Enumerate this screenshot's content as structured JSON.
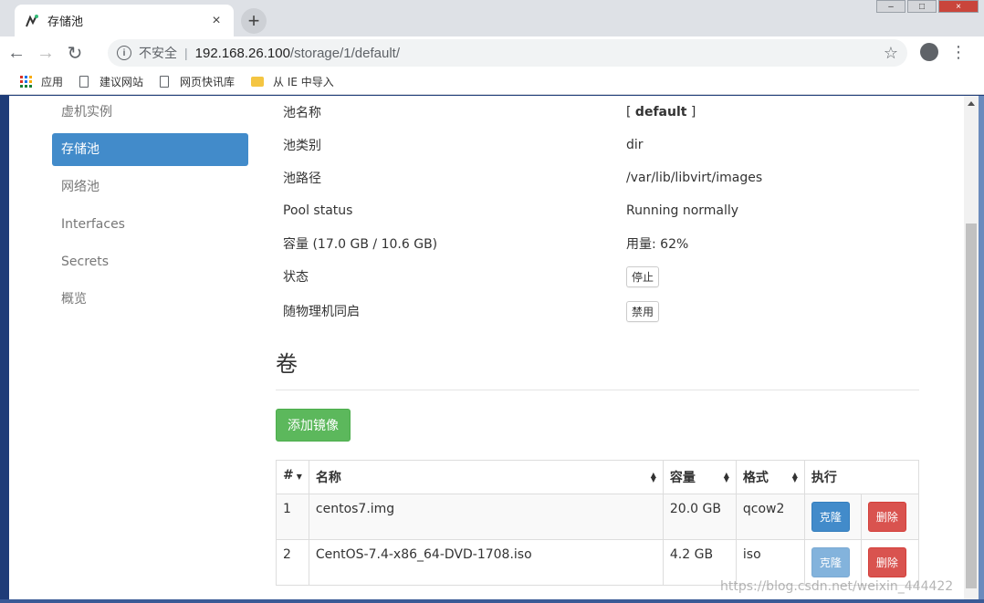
{
  "browser": {
    "tab_title": "存储池",
    "tab_close": "×",
    "new_tab": "+",
    "insecure_label": "不安全",
    "url_host": "192.168.26.100",
    "url_path": "/storage/1/default/",
    "bookmarks": [
      {
        "label": "应用",
        "icon": "apps-grid-icon"
      },
      {
        "label": "建议网站",
        "icon": "page-icon"
      },
      {
        "label": "网页快讯库",
        "icon": "page-icon"
      },
      {
        "label": "从 IE 中导入",
        "icon": "folder-icon"
      }
    ]
  },
  "sidebar": {
    "items": [
      {
        "label": "虚机实例",
        "active": false
      },
      {
        "label": "存储池",
        "active": true
      },
      {
        "label": "网络池",
        "active": false
      },
      {
        "label": "Interfaces",
        "active": false
      },
      {
        "label": "Secrets",
        "active": false
      },
      {
        "label": "概览",
        "active": false
      }
    ]
  },
  "pool": {
    "name_label": "池名称",
    "name_value_open": "[ ",
    "name_value": "default",
    "name_value_close": " ]",
    "type_label": "池类别",
    "type_value": "dir",
    "path_label": "池路径",
    "path_value": "/var/lib/libvirt/images",
    "status_label": "Pool status",
    "status_value": "Running normally",
    "capacity_label": "容量 (17.0 GB / 10.6 GB)",
    "usage_value": "用量: 62%",
    "state_label": "状态",
    "state_button": "停止",
    "autostart_label": "随物理机同启",
    "autostart_button": "禁用"
  },
  "volumes": {
    "title": "卷",
    "add_button": "添加镜像",
    "headers": {
      "num": "#",
      "name": "名称",
      "size": "容量",
      "format": "格式",
      "action": "执行"
    },
    "rows": [
      {
        "num": "1",
        "name": "centos7.img",
        "size": "20.0 GB",
        "format": "qcow2",
        "clone": "克隆",
        "delete": "删除",
        "clone_disabled": false
      },
      {
        "num": "2",
        "name": "CentOS-7.4-x86_64-DVD-1708.iso",
        "size": "4.2 GB",
        "format": "iso",
        "clone": "克隆",
        "delete": "删除",
        "clone_disabled": true
      }
    ]
  },
  "watermark": "https://blog.csdn.net/weixin_444422"
}
